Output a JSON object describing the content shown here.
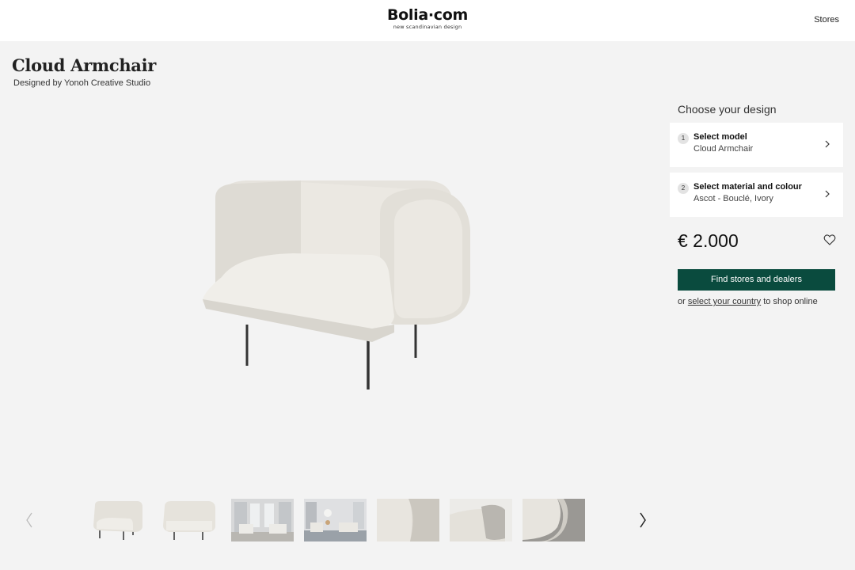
{
  "header": {
    "logo": "Bolia·com",
    "tagline": "new scandinavian design",
    "stores_link": "Stores"
  },
  "product": {
    "title": "Cloud Armchair",
    "designer": "Designed by Yonoh Creative Studio"
  },
  "configurator": {
    "heading": "Choose your design",
    "steps": [
      {
        "number": "1",
        "title": "Select model",
        "value": "Cloud Armchair"
      },
      {
        "number": "2",
        "title": "Select material and colour",
        "value": "Ascot - Bouclé, Ivory"
      }
    ],
    "price": "€ 2.000",
    "cta_label": "Find stores and dealers",
    "shop_prefix": "or ",
    "shop_link": "select your country",
    "shop_suffix": " to shop online"
  },
  "gallery": {
    "thumbnails": [
      "chair-front",
      "chair-side",
      "living-room-1",
      "living-room-2",
      "detail-armrest",
      "detail-back",
      "detail-fabric"
    ]
  },
  "colors": {
    "accent": "#0a4b3e",
    "background": "#f3f3f3"
  }
}
